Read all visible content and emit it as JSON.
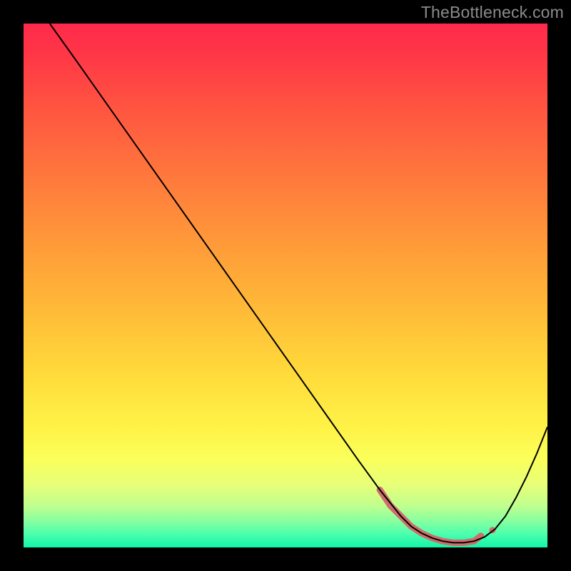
{
  "watermark": "TheBottleneck.com",
  "chart_data": {
    "type": "line",
    "title": "",
    "xlabel": "",
    "ylabel": "",
    "xlim": [
      0,
      100
    ],
    "ylim": [
      0,
      100
    ],
    "series": [
      {
        "name": "curve",
        "stroke": "#000000",
        "stroke_width": 2,
        "x": [
          5,
          10,
          16,
          22,
          28,
          34,
          40,
          46,
          52,
          58,
          64,
          68,
          72,
          74,
          76,
          78,
          80,
          82,
          84,
          86,
          88,
          90,
          92,
          94,
          96,
          98,
          100
        ],
        "y": [
          100,
          93,
          84.5,
          76,
          67.5,
          59,
          50.5,
          42,
          33.5,
          25,
          16.5,
          11,
          6,
          4,
          2.7,
          1.8,
          1.2,
          0.9,
          0.9,
          1.2,
          2,
          3.5,
          6,
          9.5,
          13.5,
          18,
          23
        ]
      },
      {
        "name": "bottom-marker",
        "stroke": "#cf6d6c",
        "stroke_width": 9,
        "linecap": "round",
        "x": [
          68,
          70,
          72,
          74,
          76,
          78,
          80,
          82,
          84,
          86,
          87.3
        ],
        "y": [
          11,
          8,
          6,
          4,
          2.7,
          1.8,
          1.2,
          0.9,
          0.9,
          1.2,
          2.2
        ]
      },
      {
        "name": "bottom-dot",
        "stroke": "#cf6d6c",
        "stroke_width": 9,
        "linecap": "round",
        "x": [
          89.5,
          89.51
        ],
        "y": [
          3.3,
          3.3
        ]
      }
    ],
    "gradient_stops": [
      {
        "offset": 0,
        "color": "#ff2a4b"
      },
      {
        "offset": 5,
        "color": "#ff3447"
      },
      {
        "offset": 17,
        "color": "#ff5740"
      },
      {
        "offset": 30,
        "color": "#ff7a3c"
      },
      {
        "offset": 42,
        "color": "#ff9a39"
      },
      {
        "offset": 55,
        "color": "#ffbb38"
      },
      {
        "offset": 67,
        "color": "#ffdb3b"
      },
      {
        "offset": 77,
        "color": "#fff247"
      },
      {
        "offset": 83,
        "color": "#fbff5a"
      },
      {
        "offset": 88,
        "color": "#e7ff78"
      },
      {
        "offset": 92,
        "color": "#c0ff8e"
      },
      {
        "offset": 95,
        "color": "#86ffa0"
      },
      {
        "offset": 97.5,
        "color": "#4affae"
      },
      {
        "offset": 100,
        "color": "#12f5a8"
      }
    ]
  }
}
